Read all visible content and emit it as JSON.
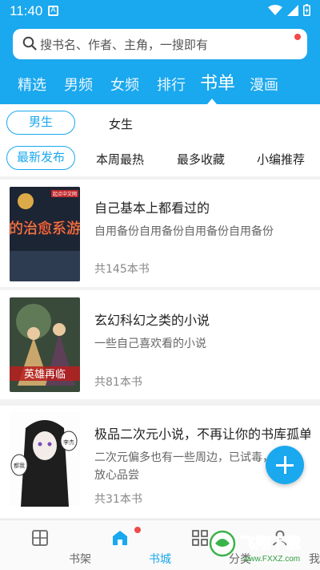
{
  "status_bar": {
    "time": "11:40",
    "notification_label": "A"
  },
  "search": {
    "placeholder": "搜书名、作者、主角，一搜即有"
  },
  "tabs": [
    {
      "label": "精选"
    },
    {
      "label": "男频"
    },
    {
      "label": "女频"
    },
    {
      "label": "排行"
    },
    {
      "label": "书单",
      "active": true
    },
    {
      "label": "漫画"
    }
  ],
  "gender_filter": {
    "male": "男生",
    "female": "女生",
    "selected": "男生"
  },
  "sort_filter": {
    "newest": "最新发布",
    "weekly_hot": "本周最热",
    "most_fav": "最多收藏",
    "editor": "小编推荐",
    "selected": "最新发布"
  },
  "booklists": [
    {
      "title": "自己基本上都看过的",
      "desc": "自用备份自用备份自用备份自用备份",
      "count": "共145本书",
      "cover_title": "我的治愈系游戏",
      "cover_badge": "起点中文网"
    },
    {
      "title": "玄幻科幻之类的小说",
      "desc": "一些自己喜欢看的小说",
      "count": "共81本书",
      "cover_title": "英雄再临"
    },
    {
      "title": "极品二次元小说，不再让你的书库孤单",
      "desc": "二次元偏多也有一些周边，已试毒，放心品尝",
      "count": "共31本书",
      "cover_bubble_1": "李杰",
      "cover_bubble_2": "都我"
    }
  ],
  "bottom_nav": [
    {
      "label": "书架",
      "icon": "bookshelf-icon"
    },
    {
      "label": "书城",
      "icon": "store-icon",
      "active": true
    },
    {
      "label": "分类",
      "icon": "category-icon"
    },
    {
      "label": "我的",
      "icon": "profile-icon"
    }
  ],
  "watermark": {
    "text": "飞翔下载",
    "url": "www.FXXZ.com"
  },
  "colors": {
    "accent": "#1aa8ee",
    "badge": "#f04a4a"
  }
}
